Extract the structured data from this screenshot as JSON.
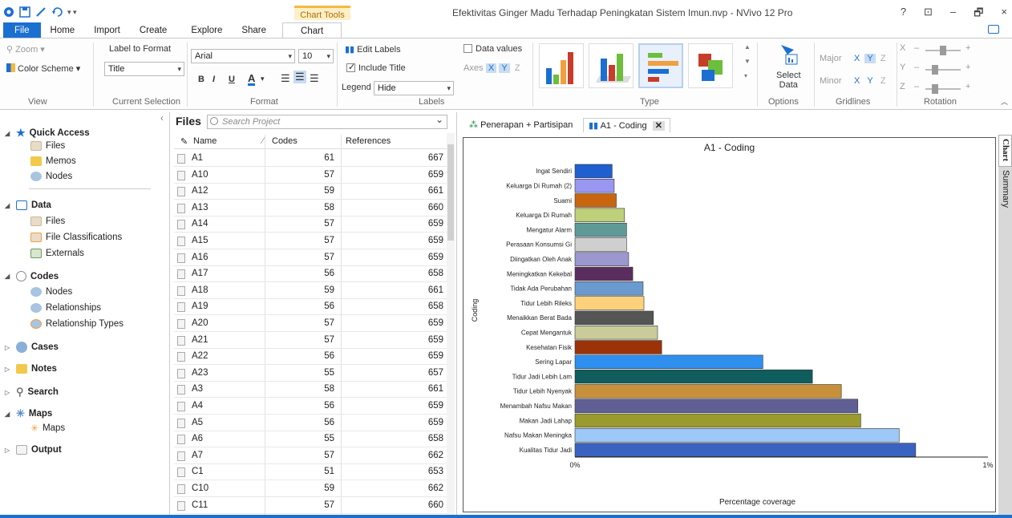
{
  "window": {
    "title": "Efektivitas Ginger Madu Terhadap Peningkatan Sistem Imun.nvp - NVivo 12 Pro",
    "context_tab": "Chart Tools",
    "controls": [
      "?",
      "⊡",
      "–",
      "🗗",
      "×"
    ]
  },
  "tabs": [
    "File",
    "Home",
    "Import",
    "Create",
    "Explore",
    "Share",
    "Chart"
  ],
  "active_tab": "Chart",
  "ribbon": {
    "view": {
      "zoom": "Zoom",
      "color_scheme": "Color Scheme",
      "label": "View"
    },
    "current_selection": {
      "label_to_format": "Label to Format",
      "value": "Title",
      "label": "Current Selection"
    },
    "format": {
      "font": "Arial",
      "size": "10",
      "bold": "B",
      "italic": "I",
      "underline": "U",
      "font_color": "A",
      "label": "Format"
    },
    "labels": {
      "edit_labels": "Edit Labels",
      "include_title": "Include Title",
      "legend_label": "Legend",
      "legend_value": "Hide",
      "label": "Labels",
      "data_values": "Data values",
      "axes": "Axes",
      "ax_x": "X",
      "ax_y": "Y",
      "ax_z": "Z"
    },
    "type": {
      "label": "Type"
    },
    "options": {
      "select_data_1": "Select",
      "select_data_2": "Data",
      "label": "Options"
    },
    "gridlines": {
      "major": "Major",
      "minor": "Minor",
      "x": "X",
      "y": "Y",
      "z": "Z",
      "label": "Gridlines"
    },
    "rotation": {
      "x": "X",
      "y": "Y",
      "z": "Z",
      "minus": "–",
      "plus": "+",
      "label": "Rotation"
    }
  },
  "nav": {
    "quick_access": {
      "label": "Quick Access",
      "items": [
        "Files",
        "Memos",
        "Nodes"
      ]
    },
    "data": {
      "label": "Data",
      "items": [
        "Files",
        "File Classifications",
        "Externals"
      ]
    },
    "codes": {
      "label": "Codes",
      "items": [
        "Nodes",
        "Relationships",
        "Relationship Types"
      ]
    },
    "cases": "Cases",
    "notes": "Notes",
    "search": "Search",
    "maps": {
      "label": "Maps",
      "items": [
        "Maps"
      ]
    },
    "output": "Output"
  },
  "files": {
    "title": "Files",
    "search_placeholder": "Search Project",
    "columns": {
      "name": "Name",
      "codes": "Codes",
      "references": "References"
    },
    "rows": [
      {
        "name": "A1",
        "codes": "61",
        "refs": "667"
      },
      {
        "name": "A10",
        "codes": "57",
        "refs": "659"
      },
      {
        "name": "A12",
        "codes": "59",
        "refs": "661"
      },
      {
        "name": "A13",
        "codes": "58",
        "refs": "660"
      },
      {
        "name": "A14",
        "codes": "57",
        "refs": "659"
      },
      {
        "name": "A15",
        "codes": "57",
        "refs": "659"
      },
      {
        "name": "A16",
        "codes": "57",
        "refs": "659"
      },
      {
        "name": "A17",
        "codes": "56",
        "refs": "658"
      },
      {
        "name": "A18",
        "codes": "59",
        "refs": "661"
      },
      {
        "name": "A19",
        "codes": "56",
        "refs": "658"
      },
      {
        "name": "A20",
        "codes": "57",
        "refs": "659"
      },
      {
        "name": "A21",
        "codes": "57",
        "refs": "659"
      },
      {
        "name": "A22",
        "codes": "56",
        "refs": "659"
      },
      {
        "name": "A23",
        "codes": "55",
        "refs": "657"
      },
      {
        "name": "A3",
        "codes": "58",
        "refs": "661"
      },
      {
        "name": "A4",
        "codes": "56",
        "refs": "659"
      },
      {
        "name": "A5",
        "codes": "56",
        "refs": "659"
      },
      {
        "name": "A6",
        "codes": "55",
        "refs": "658"
      },
      {
        "name": "A7",
        "codes": "57",
        "refs": "662"
      },
      {
        "name": "C1",
        "codes": "51",
        "refs": "653"
      },
      {
        "name": "C10",
        "codes": "59",
        "refs": "662"
      },
      {
        "name": "C11",
        "codes": "57",
        "refs": "660"
      }
    ]
  },
  "doc_tabs": [
    "Penerapan + Partisipan",
    "A1 - Coding"
  ],
  "side_tabs": [
    "Chart",
    "Summary"
  ],
  "chart_data": {
    "type": "bar",
    "orientation": "horizontal",
    "title": "A1 - Coding",
    "xlabel": "Percentage coverage",
    "ylabel": "Coding",
    "xlim": [
      0,
      1
    ],
    "x_tick_labels": [
      "0%",
      "1%"
    ],
    "categories": [
      "Ingat Sendiri",
      "Keluarga Di Rumah (2)",
      "Suami",
      "Keluarga Di Rumah",
      "Mengatur Alarm",
      "Perasaan Konsumsi Gi",
      "Diingatkan Oleh Anak",
      "Meningkatkan Kekebal",
      "Tidak Ada Perubahan",
      "Tidur Lebih Rileks",
      "Menaikkan Berat Bada",
      "Cepat Mengantuk",
      "Kesehatan Fisik",
      "Sering Lapar",
      "Tidur Jadi Lebih Lam",
      "Tidur Lebih Nyenyak",
      "Menambah Nafsu Makan",
      "Makan Jadi Lahap",
      "Nafsu Makan Meningka",
      "Kualitas Tidur Jadi"
    ],
    "values": [
      0.09,
      0.095,
      0.1,
      0.12,
      0.125,
      0.125,
      0.13,
      0.14,
      0.165,
      0.167,
      0.19,
      0.2,
      0.21,
      0.455,
      0.575,
      0.645,
      0.685,
      0.692,
      0.785,
      0.825
    ],
    "colors": [
      "#1f5fd0",
      "#9a97f2",
      "#c8650f",
      "#bfd07a",
      "#5f9a98",
      "#cfcfcf",
      "#9b98cf",
      "#5b2d5e",
      "#6b9ad0",
      "#fbd27b",
      "#555555",
      "#c9cc9a",
      "#9b3208",
      "#2f8fef",
      "#0f5d5d",
      "#c8903a",
      "#5f5f95",
      "#9a9a2e",
      "#9ec8f8",
      "#3a62c0"
    ],
    "legend": "hidden",
    "grid": false
  }
}
